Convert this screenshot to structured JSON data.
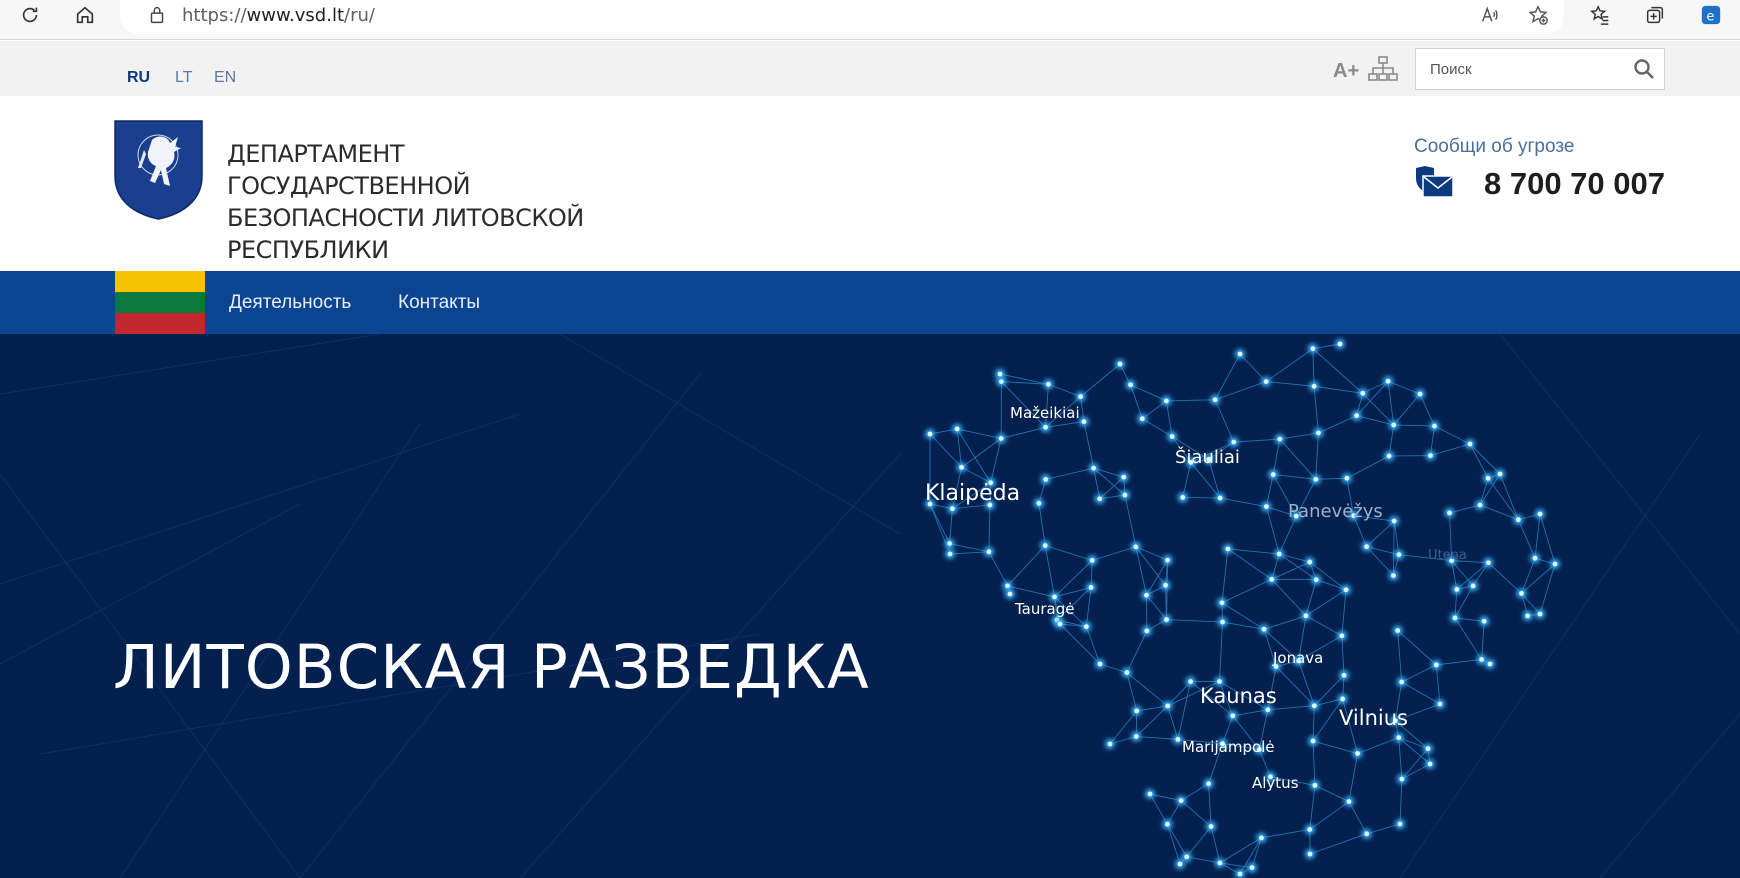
{
  "browser": {
    "url_prefix": "https://",
    "url_host": "www.vsd.lt",
    "url_path": "/ru/",
    "icons": [
      "refresh-icon",
      "home-icon",
      "lock-icon",
      "read-aloud-icon",
      "add-favorite-icon",
      "favorites-icon",
      "collections-icon",
      "edge-icon"
    ]
  },
  "utility": {
    "languages": [
      {
        "code": "RU",
        "active": true
      },
      {
        "code": "LT",
        "active": false
      },
      {
        "code": "EN",
        "active": false
      }
    ],
    "font_size_label": "A+",
    "search_placeholder": "Поиск"
  },
  "header": {
    "org_name_lines": [
      "ДЕПАРТАМЕНТ ГОСУДАРСТВЕННОЙ",
      "БЕЗОПАСНОСТИ ЛИТОВСКОЙ",
      "РЕСПУБЛИКИ"
    ],
    "threat_label": "Сообщи об угрозе",
    "phone": "8 700 70 007"
  },
  "nav": {
    "items": [
      "Деятельность",
      "Контакты"
    ],
    "flag_colors": [
      "#f7c100",
      "#0a7a3c",
      "#c1272d"
    ]
  },
  "hero": {
    "title": "ЛИТОВСКАЯ РАЗВЕДКА",
    "cities": [
      {
        "name": "Mažeikiai"
      },
      {
        "name": "Šiauliai"
      },
      {
        "name": "Klaipėda"
      },
      {
        "name": "Panevėžys"
      },
      {
        "name": "Utena"
      },
      {
        "name": "Tauragė"
      },
      {
        "name": "Jonava"
      },
      {
        "name": "Kaunas"
      },
      {
        "name": "Vilnius"
      },
      {
        "name": "Marijampolė"
      },
      {
        "name": "Alytus"
      }
    ]
  },
  "colors": {
    "nav_blue": "#0b4491",
    "hero_bg": "#04204f",
    "node_glow": "#39b6ff"
  }
}
